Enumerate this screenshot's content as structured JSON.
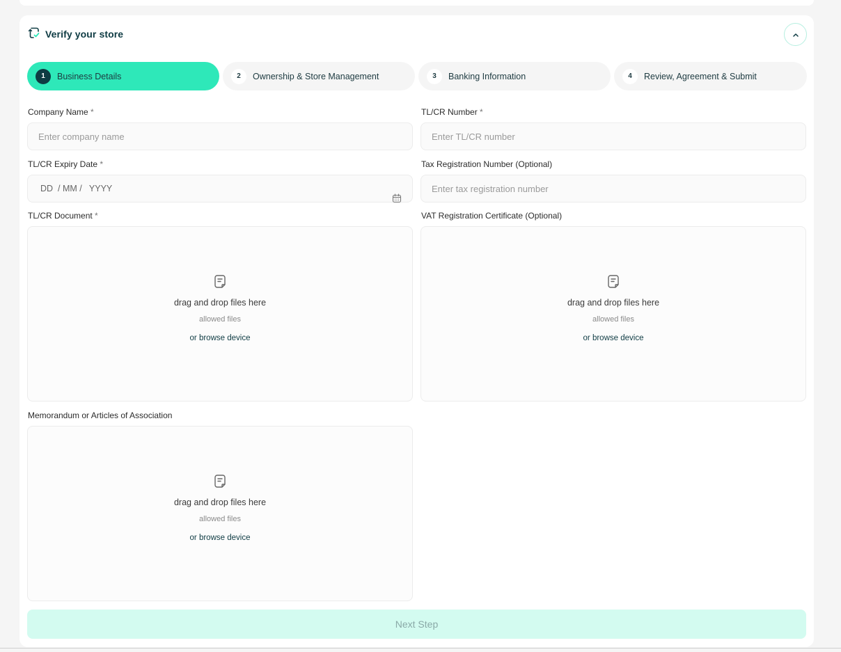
{
  "section": {
    "title": "Verify your store",
    "icon": "store-verify-icon",
    "collapse_icon": "chevron-up-icon"
  },
  "steps": [
    {
      "number": "1",
      "label": "Business Details",
      "active": true
    },
    {
      "number": "2",
      "label": "Ownership & Store Management",
      "active": false
    },
    {
      "number": "3",
      "label": "Banking Information",
      "active": false
    },
    {
      "number": "4",
      "label": "Review, Agreement & Submit",
      "active": false
    }
  ],
  "fields": {
    "company_name": {
      "label": "Company Name",
      "required_mark": "*",
      "placeholder": "Enter company name"
    },
    "tlcr_number": {
      "label": "TL/CR Number",
      "required_mark": "*",
      "placeholder": "Enter TL/CR number"
    },
    "tlcr_expiry": {
      "label": "TL/CR Expiry Date",
      "required_mark": "*",
      "placeholder": "DD  / MM /   YYYY"
    },
    "tax_reg": {
      "label": "Tax Registration Number (Optional)",
      "placeholder": "Enter tax registration number"
    },
    "tlcr_document": {
      "label": "TL/CR Document",
      "required_mark": "*"
    },
    "vat_certificate": {
      "label": "VAT Registration Certificate (Optional)"
    },
    "memorandum": {
      "label": "Memorandum or Articles of Association"
    }
  },
  "dropzone": {
    "title": "drag and drop files here",
    "allowed": "allowed files",
    "browse": "or browse device"
  },
  "next_button": "Next Step",
  "colors": {
    "accent": "#2ee8b9",
    "dark": "#0e3b43",
    "button_disabled_bg": "#d3fbf0"
  }
}
